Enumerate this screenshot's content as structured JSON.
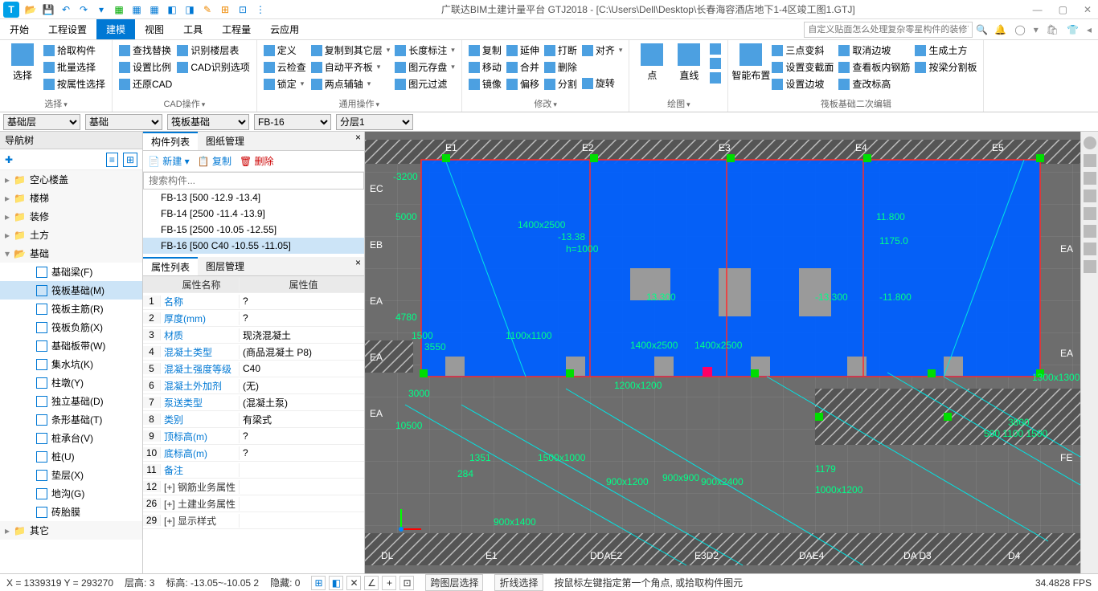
{
  "title": "广联达BIM土建计量平台 GTJ2018 - [C:\\Users\\Dell\\Desktop\\长春海容酒店地下1-4区竣工图1.GTJ]",
  "menu": {
    "tabs": [
      "开始",
      "工程设置",
      "建模",
      "视图",
      "工具",
      "工程量",
      "云应用"
    ],
    "active": 2,
    "searchPH": "自定义贴面怎么处理复杂零星构件的装修？"
  },
  "ribbon": {
    "sel": {
      "label": "选择",
      "items": [
        "拾取构件",
        "批量选择",
        "按属性选择"
      ],
      "main": "选择"
    },
    "cad": {
      "label": "CAD操作",
      "items": [
        "查找替换",
        "设置比例",
        "还原CAD",
        "识别楼层表",
        "CAD识别选项",
        "定义",
        "云检查",
        "锁定"
      ]
    },
    "common": {
      "label": "通用操作",
      "items": [
        "复制到其它层",
        "自动平齐板",
        "两点辅轴",
        "长度标注",
        "图元存盘",
        "图元过滤"
      ]
    },
    "modify": {
      "label": "修改",
      "items": [
        "复制",
        "移动",
        "镜像",
        "延伸",
        "合并",
        "偏移",
        "打断",
        "删除",
        "分割",
        "对齐",
        "旋转"
      ]
    },
    "draw": {
      "label": "绘图",
      "items": [
        "点",
        "直线",
        "智能布置"
      ]
    },
    "raft": {
      "label": "筏板基础二次编辑",
      "items": [
        "三点变斜",
        "设置变截面",
        "设置边坡",
        "取消边坡",
        "查看板内钢筋",
        "查改标高",
        "生成土方",
        "按梁分割板"
      ]
    }
  },
  "selectorbar": {
    "opts1": "基础层",
    "opts2": "基础",
    "opts3": "筏板基础",
    "opts4": "FB-16",
    "opts5": "分层1"
  },
  "nav": {
    "title": "导航树",
    "cats": [
      "空心楼盖",
      "楼梯",
      "装修",
      "土方",
      "基础",
      "其它"
    ],
    "items": [
      "基础梁(F)",
      "筏板基础(M)",
      "筏板主筋(R)",
      "筏板负筋(X)",
      "基础板带(W)",
      "集水坑(K)",
      "柱墩(Y)",
      "独立基础(D)",
      "条形基础(T)",
      "桩承台(V)",
      "桩(U)",
      "垫层(X)",
      "地沟(G)",
      "砖胎膜"
    ],
    "sel": 1
  },
  "comp": {
    "tab1": "构件列表",
    "tab2": "图纸管理",
    "btnNew": "新建",
    "btnCopy": "复制",
    "btnDel": "删除",
    "searchPH": "搜索构件...",
    "list": [
      "FB-13 [500 -12.9 -13.4]",
      "FB-14 [2500 -11.4 -13.9]",
      "FB-15 [2500 -10.05 -12.55]",
      "FB-16 [500 C40 -10.55 -11.05]"
    ],
    "sel": 3
  },
  "prop": {
    "tab1": "属性列表",
    "tab2": "图层管理",
    "h1": "属性名称",
    "h2": "属性值",
    "rows": [
      {
        "n": "1",
        "k": "名称",
        "v": "?"
      },
      {
        "n": "2",
        "k": "厚度(mm)",
        "v": "?"
      },
      {
        "n": "3",
        "k": "材质",
        "v": "现浇混凝土"
      },
      {
        "n": "4",
        "k": "混凝土类型",
        "v": "(商品混凝土 P8)"
      },
      {
        "n": "5",
        "k": "混凝土强度等级",
        "v": "C40"
      },
      {
        "n": "6",
        "k": "混凝土外加剂",
        "v": "(无)"
      },
      {
        "n": "7",
        "k": "泵送类型",
        "v": "(混凝土泵)"
      },
      {
        "n": "8",
        "k": "类别",
        "v": "有梁式"
      },
      {
        "n": "9",
        "k": "顶标高(m)",
        "v": "?"
      },
      {
        "n": "10",
        "k": "底标高(m)",
        "v": "?"
      },
      {
        "n": "11",
        "k": "备注",
        "v": ""
      },
      {
        "n": "12",
        "k": "[+] 钢筋业务属性",
        "v": "",
        "plain": true
      },
      {
        "n": "26",
        "k": "[+] 土建业务属性",
        "v": "",
        "plain": true
      },
      {
        "n": "29",
        "k": "[+] 显示样式",
        "v": "",
        "plain": true
      }
    ]
  },
  "canvas": {
    "gridTop": [
      "E1",
      "E2",
      "E3",
      "E4",
      "E5"
    ],
    "gridLeft": [
      "EC",
      "EB",
      "EA",
      "EA",
      "EA"
    ],
    "gridBot": [
      "DL",
      "E1",
      "DDAE2",
      "E3D2",
      "DAE4",
      "DA D3",
      "D4"
    ],
    "gridRight": [
      "EA",
      "EA",
      "FE"
    ],
    "labels": [
      "1400x2500",
      "-13.38",
      "h=1000",
      "1500",
      "1100x1100",
      "3550",
      "3000",
      "13.300",
      "1400x2500",
      "1400x2500",
      "-13,300",
      "11.800",
      "1175.0",
      "-11.800",
      "1200x1200",
      "1300x1300",
      "3800",
      "500 1100 1500",
      "1500x1000",
      "900x1200",
      "900x900",
      "1000x1200",
      "1179",
      "900x2400",
      "900x1400",
      "1351",
      "284",
      "-3200",
      "5000",
      "4780",
      "10500"
    ]
  },
  "status": {
    "coord": "X = 1339319 Y = 293270",
    "floor": "层高:   3",
    "elev": "标高:   -13.05~-10.05   2",
    "hide": "隐藏:   0",
    "b1": "跨图层选择",
    "b2": "折线选择",
    "hint": "按鼠标左键指定第一个角点, 或拾取构件图元",
    "fps": "34.4828 FPS"
  }
}
